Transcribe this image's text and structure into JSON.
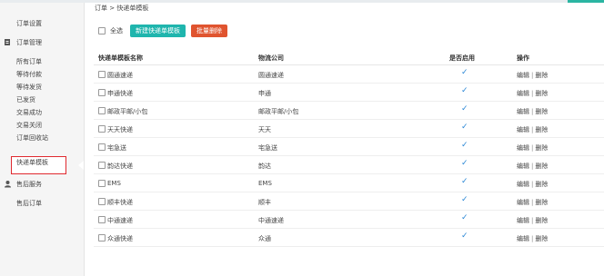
{
  "breadcrumb": {
    "root": "订单",
    "sep": ">",
    "current": "快递单模板"
  },
  "sidebar": {
    "items": [
      {
        "label": "订单设置"
      },
      {
        "label": "订单管理"
      },
      {
        "label": "所有订单"
      },
      {
        "label": "等待付款"
      },
      {
        "label": "等待发货"
      },
      {
        "label": "已发货"
      },
      {
        "label": "交易成功"
      },
      {
        "label": "交易关闭"
      },
      {
        "label": "订单回收站"
      },
      {
        "label": "快递单模板"
      },
      {
        "label": "售后服务"
      },
      {
        "label": "售后订单"
      }
    ]
  },
  "toolbar": {
    "select_all": "全选",
    "new_label": "新建快递单模板",
    "batch_delete": "批量删除"
  },
  "table": {
    "headers": {
      "name": "快递单模板名称",
      "company": "物流公司",
      "enabled": "是否启用",
      "ops": "操作"
    },
    "rows": [
      {
        "name": "圆通速递",
        "company": "圆通速递",
        "enabled": "✓",
        "edit": "编辑",
        "sep": "|",
        "delete": "删除"
      },
      {
        "name": "申通快递",
        "company": "申通",
        "enabled": "✓",
        "edit": "编辑",
        "sep": "|",
        "delete": "删除"
      },
      {
        "name": "邮政平邮/小包",
        "company": "邮政平邮/小包",
        "enabled": "✓",
        "edit": "编辑",
        "sep": "|",
        "delete": "删除"
      },
      {
        "name": "天天快递",
        "company": "天天",
        "enabled": "✓",
        "edit": "编辑",
        "sep": "|",
        "delete": "删除"
      },
      {
        "name": "宅急送",
        "company": "宅急送",
        "enabled": "✓",
        "edit": "编辑",
        "sep": "|",
        "delete": "删除"
      },
      {
        "name": "韵达快递",
        "company": "韵达",
        "enabled": "✓",
        "edit": "编辑",
        "sep": "|",
        "delete": "删除"
      },
      {
        "name": "EMS",
        "company": "EMS",
        "enabled": "✓",
        "edit": "编辑",
        "sep": "|",
        "delete": "删除"
      },
      {
        "name": "顺丰快递",
        "company": "顺丰",
        "enabled": "✓",
        "edit": "编辑",
        "sep": "|",
        "delete": "删除"
      },
      {
        "name": "中通速递",
        "company": "中通速递",
        "enabled": "✓",
        "edit": "编辑",
        "sep": "|",
        "delete": "删除"
      },
      {
        "name": "众通快递",
        "company": "众通",
        "enabled": "✓",
        "edit": "编辑",
        "sep": "|",
        "delete": "删除"
      }
    ]
  },
  "colors": {
    "accent": "#1fb5ad",
    "danger": "#e0542f",
    "highlight_border": "#e0292f",
    "check": "#2a87d6"
  }
}
